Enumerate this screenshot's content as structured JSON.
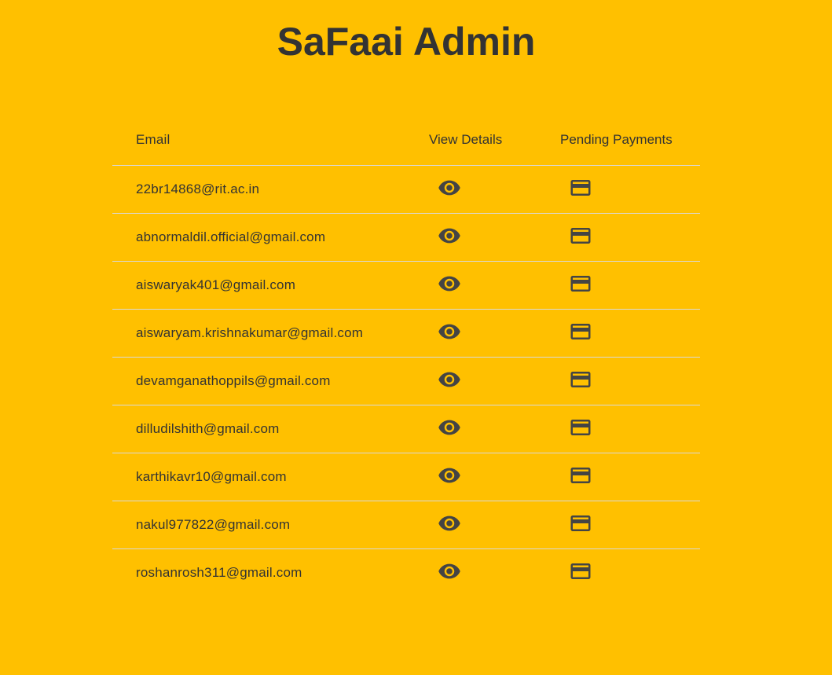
{
  "header": {
    "title": "SaFaai Admin"
  },
  "table": {
    "columns": {
      "email": "Email",
      "view_details": "View Details",
      "pending_payments": "Pending Payments"
    },
    "rows": [
      {
        "email": "22br14868@rit.ac.in"
      },
      {
        "email": "abnormaldil.official@gmail.com"
      },
      {
        "email": "aiswaryak401@gmail.com"
      },
      {
        "email": "aiswaryam.krishnakumar@gmail.com"
      },
      {
        "email": "devamganathoppils@gmail.com"
      },
      {
        "email": "dilludilshith@gmail.com"
      },
      {
        "email": "karthikavr10@gmail.com"
      },
      {
        "email": "nakul977822@gmail.com"
      },
      {
        "email": "roshanrosh311@gmail.com"
      }
    ]
  },
  "icons": {
    "view": "visibility-icon",
    "payment": "credit-card-icon"
  },
  "colors": {
    "background": "#FFC000",
    "text": "#333333",
    "icon": "#444444",
    "divider": "#d9d9d9"
  }
}
